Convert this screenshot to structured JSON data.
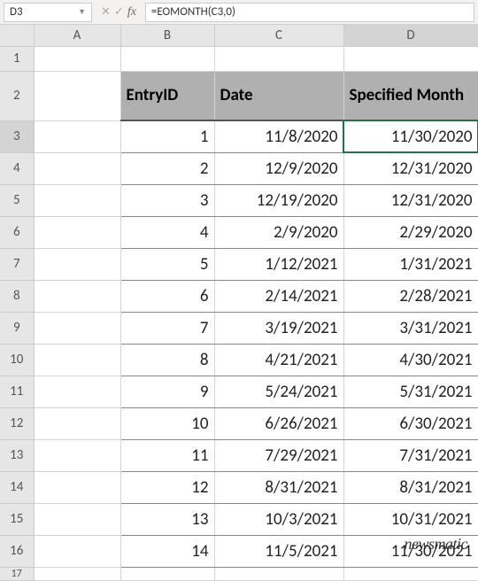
{
  "toolbar": {
    "name_box": "D3",
    "formula": "=EOMONTH(C3,0)",
    "cancel_icon": "✕",
    "enter_icon": "✓",
    "fx_label": "fx"
  },
  "columns": [
    "A",
    "B",
    "C",
    "D"
  ],
  "active_column": "D",
  "active_row": "3",
  "headers": {
    "B": "EntryID",
    "C": "Date",
    "D": "Specified Month"
  },
  "rows": [
    {
      "n": "1",
      "B": "",
      "C": "",
      "D": ""
    },
    {
      "n": "2",
      "B": "EntryID",
      "C": "Date",
      "D": "Specified Month"
    },
    {
      "n": "3",
      "B": "1",
      "C": "11/8/2020",
      "D": "11/30/2020"
    },
    {
      "n": "4",
      "B": "2",
      "C": "12/9/2020",
      "D": "12/31/2020"
    },
    {
      "n": "5",
      "B": "3",
      "C": "12/19/2020",
      "D": "12/31/2020"
    },
    {
      "n": "6",
      "B": "4",
      "C": "2/9/2020",
      "D": "2/29/2020"
    },
    {
      "n": "7",
      "B": "5",
      "C": "1/12/2021",
      "D": "1/31/2021"
    },
    {
      "n": "8",
      "B": "6",
      "C": "2/14/2021",
      "D": "2/28/2021"
    },
    {
      "n": "9",
      "B": "7",
      "C": "3/19/2021",
      "D": "3/31/2021"
    },
    {
      "n": "10",
      "B": "8",
      "C": "4/21/2021",
      "D": "4/30/2021"
    },
    {
      "n": "11",
      "B": "9",
      "C": "5/24/2021",
      "D": "5/31/2021"
    },
    {
      "n": "12",
      "B": "10",
      "C": "6/26/2021",
      "D": "6/30/2021"
    },
    {
      "n": "13",
      "B": "11",
      "C": "7/29/2021",
      "D": "7/31/2021"
    },
    {
      "n": "14",
      "B": "12",
      "C": "8/31/2021",
      "D": "8/31/2021"
    },
    {
      "n": "15",
      "B": "13",
      "C": "10/3/2021",
      "D": "10/31/2021"
    },
    {
      "n": "16",
      "B": "14",
      "C": "11/5/2021",
      "D": "11/30/2021"
    }
  ],
  "extra_row": "17",
  "watermark": "newsmatic"
}
